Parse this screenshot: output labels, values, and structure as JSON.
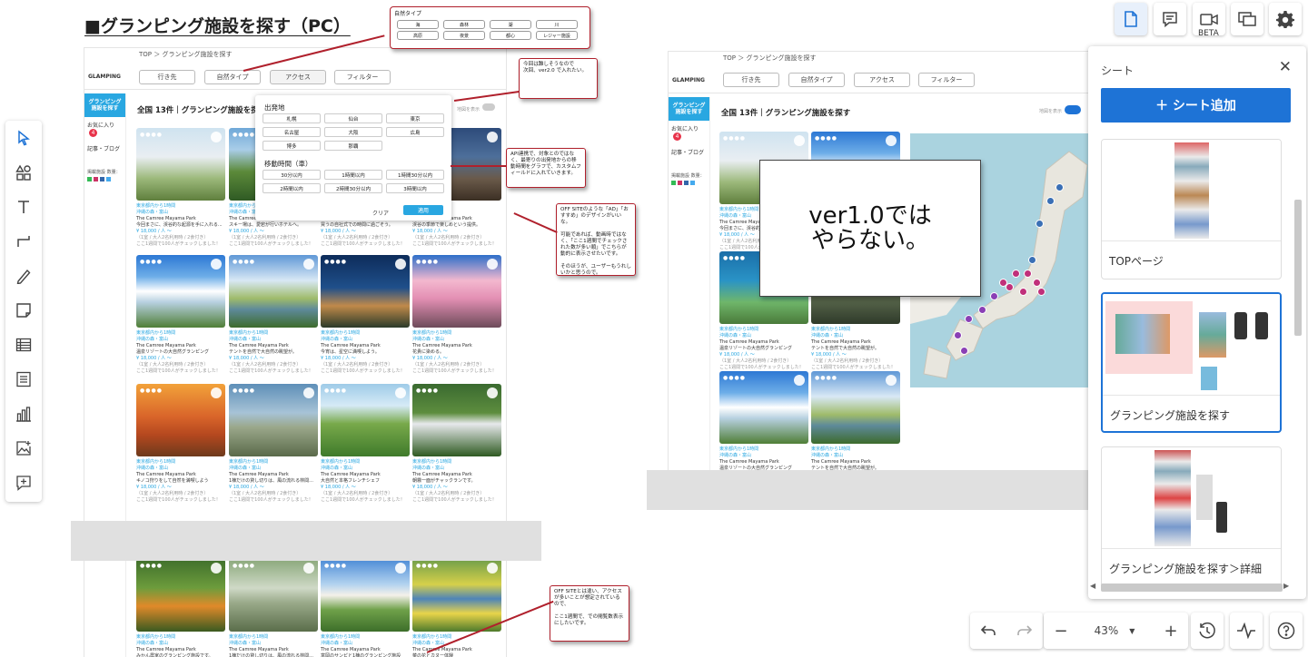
{
  "board_title": "■グランピング施設を探す（PC）",
  "wire": {
    "breadcrumb": "TOP  ＞  グランピング施設を探す",
    "logo": "GLAMPING",
    "tabs": [
      "行き先",
      "自然タイプ",
      "アクセス",
      "フィルター"
    ],
    "side_active": "グランピング\n施設を探す",
    "side_fav": "お気に入り",
    "side_fav_count": "4",
    "side_blog": "記事・ブログ",
    "side_count_label": "掲載施設 数量：",
    "list_title": "全国 13件｜グランピング施設を探す",
    "toggle_label": "地図を表示",
    "card": {
      "area": "東京都内から1時間",
      "location": "沖縄の森・富山",
      "name": "The Camree Mayama Park",
      "price": "¥ 18,000 / 人 〜",
      "price_note": "（1室 / 大人2名利用時 / 2食付き）",
      "meta": "ここ1週間で100人がチェックしました！"
    },
    "descs": [
      "今回まさに、渓谷的な起源を手に入れる...",
      "スキー場は、愛宕が行いホテルへ。",
      "買うの自社式での時間に過ごそう。",
      "渓谷の季節で楽しめという提供。",
      "温泉リゾートの大自然グランピング",
      "テントを自然で大自然の眺望が。",
      "今宵は、星空に満喫しよう。",
      "花貴に染める。",
      "キノコ狩りをして自然を満喫しよう",
      "1棟だけの貸し切りは、風の流れる林間...",
      "大自然と本格フレンチシェフ",
      "朝霧一面がチャックランです。",
      "みかん農家のグランピング施設です。",
      "1棟だけの貸し切りは、風の流れる林間...",
      "富岡のサンピと1棟のグランピング施設",
      "菜の花とカヌー体験"
    ]
  },
  "dropdowns": {
    "nature_title": "自然タイプ",
    "nature_chips": [
      "海",
      "森林",
      "湖",
      "川",
      "高原",
      "夜景",
      "都心",
      "レジャー施設"
    ],
    "access_from_title": "出発地",
    "access_from": [
      "札幌",
      "仙台",
      "東京",
      "名古屋",
      "大阪",
      "広島",
      "博多",
      "那覇"
    ],
    "access_time_title": "移動時間（車）",
    "access_time": [
      "30分以内",
      "1時間以内",
      "1時間30分以内",
      "2時間以内",
      "2時間30分以内",
      "3時間以内"
    ],
    "clear_label": "クリア",
    "apply_label": "適用"
  },
  "notes": {
    "n1": "今回は難しそうなので\n次回、ver2.0 で入れたい。",
    "n2": "API連携で、対象とのではなく、最寄りの出発地からの移動時間をグラフで、カスタムフィールドに入れていきます。",
    "n3": "OFF SITEのような「AD」「おすすめ」のデザインがいいな。\n\n可能であれば、動画時ではなく、「ここ1週間でチェックされた数が多い順」でこちらが動的に表示させたいです。\n\nそのほうが、ユーザーもうれしいかと思うので。",
    "n4": "OFF SITEとは違い、アクセスが多いことが想定されているので、\n\nここ1週間で、での閲覧数表示にしたいです。",
    "big": "ver1.0では\nやらない。"
  },
  "left_tools": [
    "select-icon",
    "shapes-icon",
    "text-icon",
    "connector-icon",
    "pen-icon",
    "sticky-note-icon",
    "table-icon",
    "text-block-icon",
    "chart-icon",
    "image-icon",
    "comment-add-icon"
  ],
  "top_tools": {
    "beta_label": "BETA"
  },
  "panel": {
    "title": "シート",
    "add_label": "＋ シート追加",
    "sheets": [
      "TOPページ",
      "グランピング施設を探す",
      "グランピング施設を探す＞詳細"
    ]
  },
  "bottom": {
    "zoom": "43%"
  },
  "colors": {
    "accent": "#1e73d6",
    "note_border": "#b0202c",
    "site_blue": "#29a7e1",
    "badge_red": "#e8334a"
  }
}
